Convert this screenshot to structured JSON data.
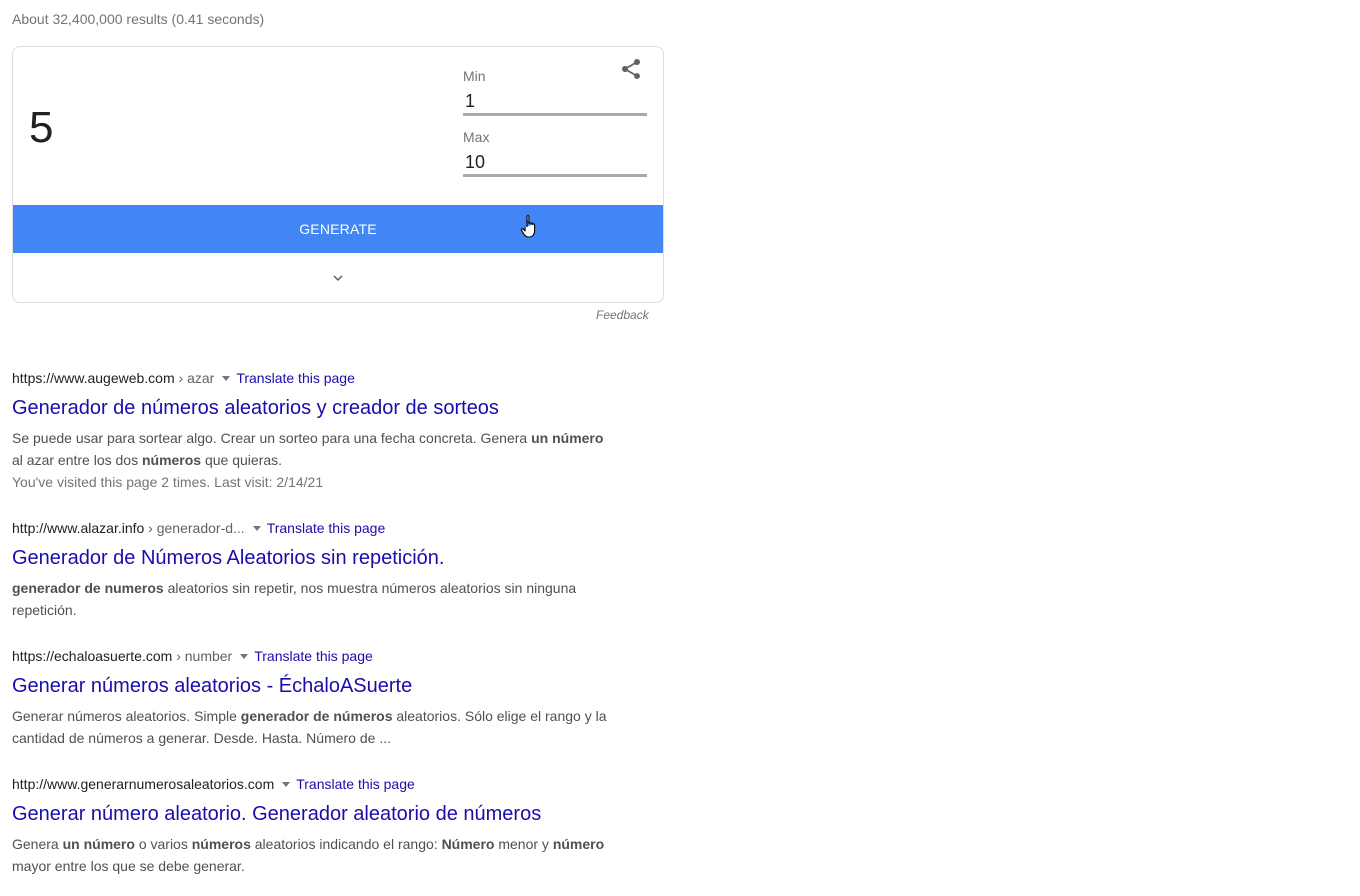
{
  "stats": "About 32,400,000 results (0.41 seconds)",
  "widget": {
    "result": "5",
    "min_label": "Min",
    "min_value": "1",
    "max_label": "Max",
    "max_value": "10",
    "generate_label": "GENERATE",
    "feedback": "Feedback",
    "button_color": "#4285f4",
    "icons": [
      "share-icon",
      "chevron-down-icon",
      "hand-cursor-icon"
    ]
  },
  "results": [
    {
      "domain": "https://www.augeweb.com",
      "path": " › azar",
      "translate": "Translate this page",
      "title": "Generador de números aleatorios y creador de sorteos",
      "snippet": [
        [
          "Se puede usar para sortear algo. Crear un sorteo para una fecha concreta. Genera ",
          false
        ],
        [
          "un número",
          true
        ],
        [
          " al azar entre los dos ",
          false
        ],
        [
          "números",
          true
        ],
        [
          " que quieras.",
          false
        ]
      ],
      "visited": "You've visited this page 2 times. Last visit: 2/14/21"
    },
    {
      "domain": "http://www.alazar.info",
      "path": " › generador-d...",
      "translate": "Translate this page",
      "title": "Generador de Números Aleatorios sin repetición.",
      "snippet": [
        [
          "generador de numeros",
          true
        ],
        [
          " aleatorios sin repetir, nos muestra números aleatorios sin ninguna repetición.",
          false
        ]
      ]
    },
    {
      "domain": "https://echaloasuerte.com",
      "path": " › number",
      "translate": "Translate this page",
      "title": "Generar números aleatorios - ÉchaloASuerte",
      "snippet": [
        [
          "Generar números aleatorios. Simple ",
          false
        ],
        [
          "generador de números",
          true
        ],
        [
          " aleatorios. Sólo elige el rango y la cantidad de números a generar. Desde. Hasta. Número de ...",
          false
        ]
      ]
    },
    {
      "domain": "http://www.generarnumerosaleatorios.com",
      "path": "",
      "translate": "Translate this page",
      "title": "Generar número aleatorio. Generador aleatorio de números",
      "snippet": [
        [
          "Genera ",
          false
        ],
        [
          "un número",
          true
        ],
        [
          " o varios ",
          false
        ],
        [
          "números",
          true
        ],
        [
          " aleatorios indicando el rango: ",
          false
        ],
        [
          "Número",
          true
        ],
        [
          " menor y ",
          false
        ],
        [
          "número",
          true
        ],
        [
          " mayor entre los que se debe generar.",
          false
        ]
      ]
    }
  ]
}
